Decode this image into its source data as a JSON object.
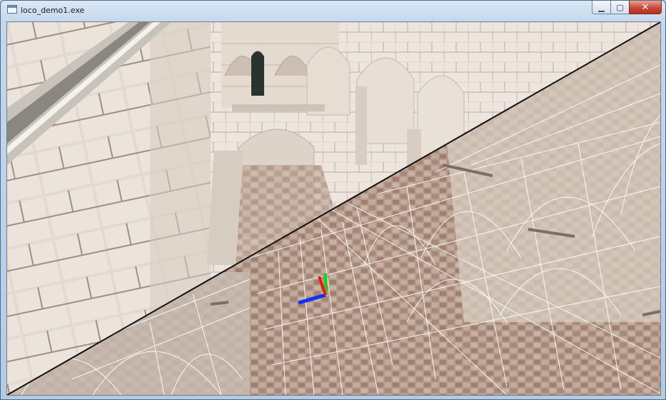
{
  "window": {
    "title": "loco_demo1.exe",
    "buttons": {
      "minimize": "▁",
      "maximize": "▢",
      "close": "✕"
    }
  },
  "viewport": {
    "scene": "3d-render",
    "split": "diagonal",
    "upper_mode": "textured",
    "lower_mode": "wireframe",
    "gizmo": {
      "x_axis_color": "#1030ff",
      "y_axis_color": "#22cc22",
      "z_axis_color": "#ee1515"
    }
  }
}
